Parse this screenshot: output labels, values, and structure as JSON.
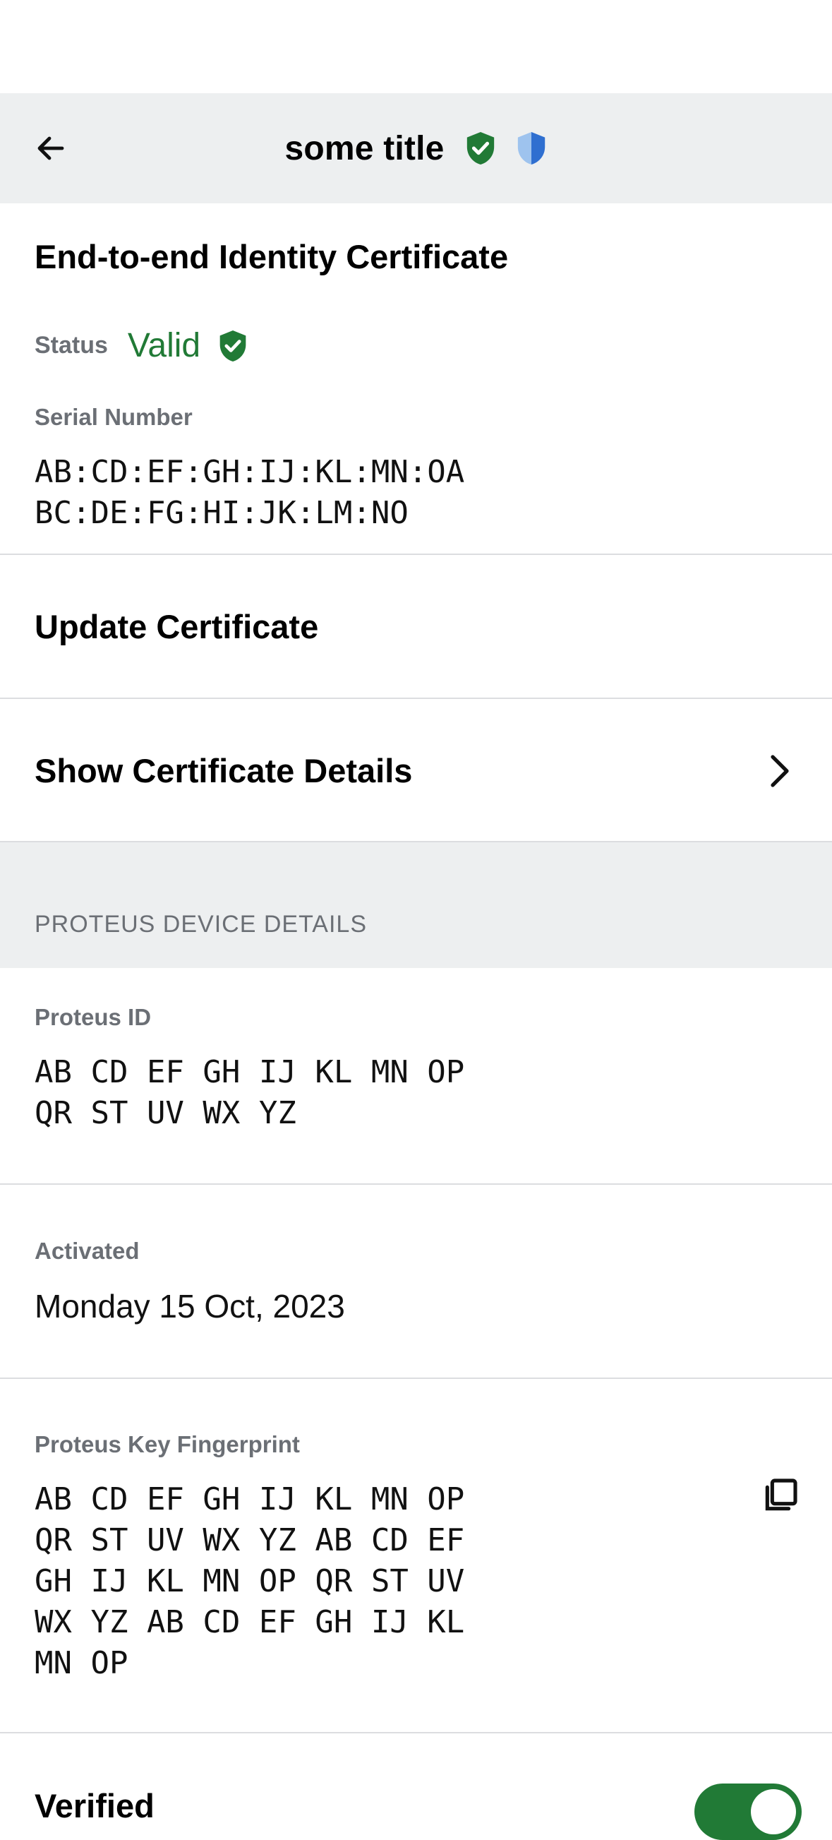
{
  "header": {
    "title": "some title",
    "back_icon": "arrow-left-icon",
    "verified_icon": "shield-check-icon",
    "proteus_icon": "shield-half-icon"
  },
  "certificate": {
    "heading": "End-to-end Identity Certificate",
    "status_label": "Status",
    "status_value": "Valid",
    "serial_label": "Serial Number",
    "serial_value": "AB:CD:EF:GH:IJ:KL:MN:OA\nBC:DE:FG:HI:JK:LM:NO",
    "update_label": "Update Certificate",
    "details_label": "Show Certificate Details"
  },
  "proteus": {
    "section_title": "PROTEUS DEVICE DETAILS",
    "id_label": "Proteus ID",
    "id_value": "AB CD EF GH IJ KL MN OP\nQR ST UV WX YZ",
    "activated_label": "Activated",
    "activated_value": "Monday 15 Oct, 2023",
    "fingerprint_label": "Proteus Key Fingerprint",
    "fingerprint_value": "AB CD EF GH IJ KL MN OP\nQR ST UV WX YZ AB CD EF\nGH IJ KL MN OP QR ST UV\nWX YZ AB CD EF GH IJ KL\nMN OP"
  },
  "verified": {
    "label": "Verified",
    "toggle_on": true
  },
  "colors": {
    "accent_green": "#217a36",
    "shield_blue": "#2f6fd0",
    "band_gray": "#edeff0"
  }
}
